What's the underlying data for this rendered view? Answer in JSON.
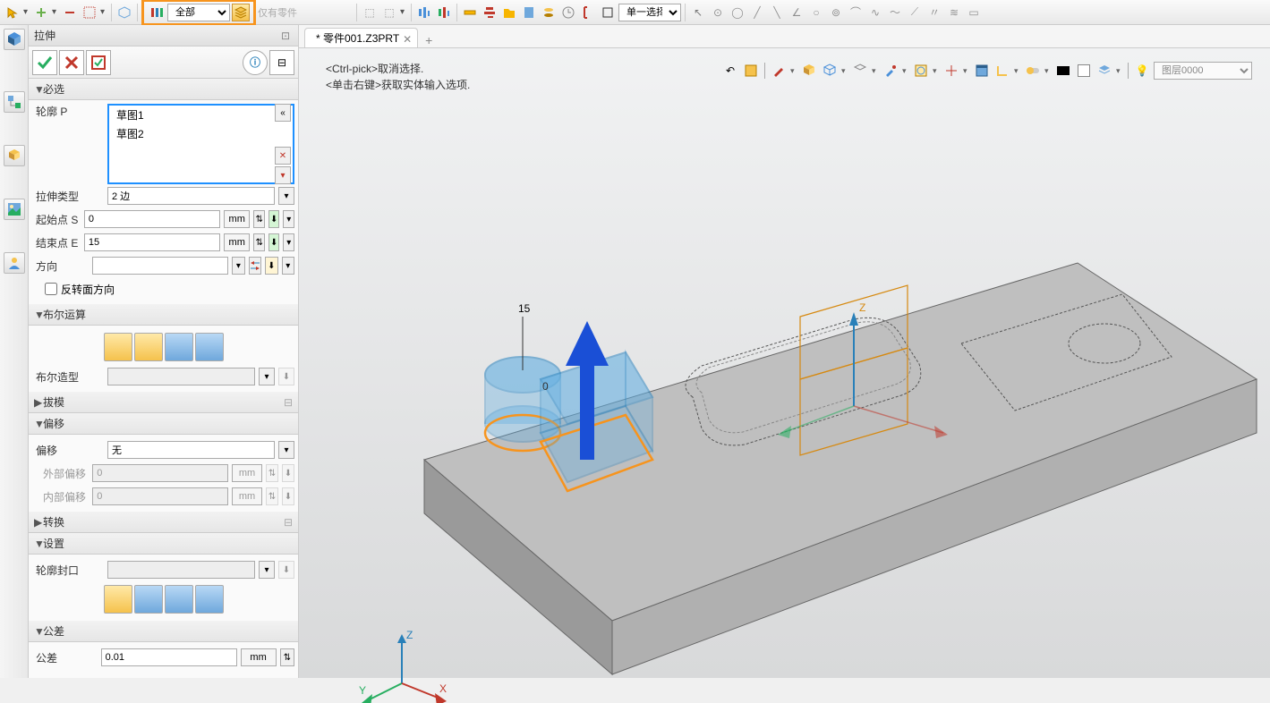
{
  "top_toolbar": {
    "filter_label": "全部",
    "select_mode": "单一选择",
    "dim_text": "仅有零件"
  },
  "panel": {
    "title": "拉伸",
    "section_required": "必选",
    "profile_label": "轮廓 P",
    "profiles": [
      "草图1",
      "草图2"
    ],
    "extrude_type_label": "拉伸类型",
    "extrude_type_value": "2 边",
    "start_label": "起始点 S",
    "start_value": "0",
    "end_label": "结束点 E",
    "end_value": "15",
    "direction_label": "方向",
    "direction_value": "",
    "reverse_label": "反转面方向",
    "unit_mm": "mm",
    "section_boolean": "布尔运算",
    "bool_shape_label": "布尔造型",
    "bool_shape_value": "",
    "section_draft": "拔模",
    "section_offset": "偏移",
    "offset_label": "偏移",
    "offset_value": "无",
    "outer_label": "外部偏移",
    "outer_value": "0",
    "inner_label": "内部偏移",
    "inner_value": "0",
    "section_transform": "转换",
    "section_settings": "设置",
    "cap_label": "轮廓封口",
    "cap_value": "",
    "section_tolerance": "公差",
    "tolerance_label": "公差",
    "tolerance_value": "0.01"
  },
  "viewport": {
    "tab_name": "* 零件001.Z3PRT",
    "hint1": "<Ctrl-pick>取消选择.",
    "hint2": "<单击右键>获取实体输入选项.",
    "dimension_text": "15",
    "axis_z": "Z",
    "axis_y": "Y",
    "axis_x": "X",
    "origin": "0",
    "layer_select": "图层0000"
  }
}
